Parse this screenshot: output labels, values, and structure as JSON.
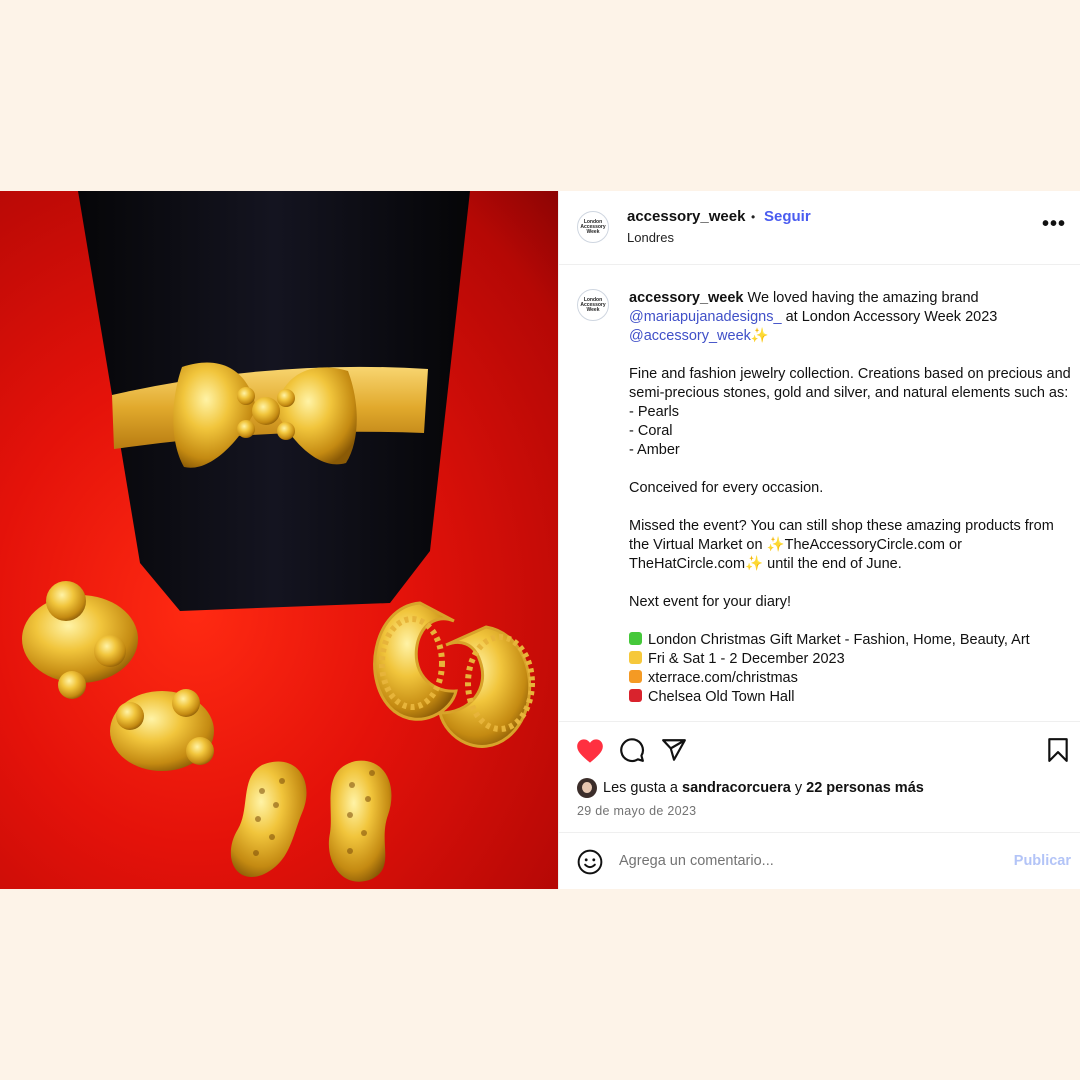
{
  "post": {
    "username": "accessory_week",
    "follow_label": "Seguir",
    "location": "Londres",
    "avatar_text": "London Accessory Week",
    "more_label": "•••"
  },
  "caption": {
    "username": "accessory_week",
    "intro": "We loved having the amazing brand",
    "mention_brand": "@mariapujanadesigns_",
    "intro_tail": "at London Accessory Week 2023",
    "mention_self": "@accessory_week✨",
    "line_collection_1": "Fine and fashion jewelry collection. Creations based on precious and semi-precious stones, gold and silver, and natural elements such as:",
    "list": [
      "- Pearls",
      "- Coral",
      "- Amber"
    ],
    "occasion": "Conceived for every occasion.",
    "missed_1": "Missed the event? You can still shop these amazing products from the Virtual Market on",
    "missed_site_1": "✨TheAccessoryCircle.com",
    "missed_or": "or",
    "missed_site_2": "TheHatCircle.com✨",
    "missed_tail": "until the end of June.",
    "next_event": "Next event for your diary!",
    "events": [
      {
        "text": "London Christmas Gift Market - Fashion, Home, Beauty, Art",
        "color": "#45c83a",
        "icon": "green-heart"
      },
      {
        "text": "Fri & Sat 1 - 2 December 2023",
        "color": "#f6c83b",
        "icon": "yellow-heart"
      },
      {
        "text": "xterrace.com/christmas",
        "color": "#f49a24",
        "icon": "orange-heart"
      },
      {
        "text": "Chelsea Old Town Hall",
        "color": "#d9232d",
        "icon": "red-heart"
      }
    ]
  },
  "actions": {
    "likes_prefix": "Les gusta a",
    "likes_user": "sandracorcuera",
    "likes_join": "y",
    "likes_count": "22 personas más",
    "date": "29 de mayo de 2023",
    "comment_placeholder": "Agrega un comentario...",
    "publish_label": "Publicar",
    "like_color": "#ff3040"
  }
}
